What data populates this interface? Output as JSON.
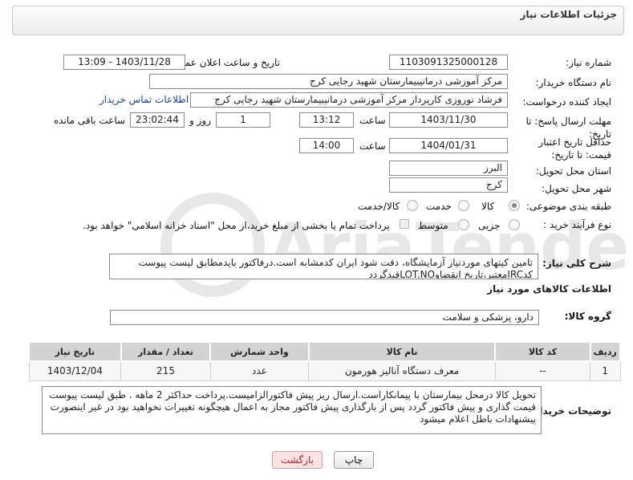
{
  "header": {
    "title": "جزئیات اطلاعات نیاز"
  },
  "form": {
    "need_number": {
      "label": "شماره نیاز:",
      "value": "1103091325000128"
    },
    "announce_datetime": {
      "label": "تاریخ و ساعت اعلان عمومی:",
      "value": "1403/11/28 - 13:09"
    },
    "buyer_org": {
      "label": "نام دستگاه خریدار:",
      "value": "مرکز آموزشی درمانیبیمارستان شهید رجایی کرج"
    },
    "creator": {
      "label": "ایجاد کننده درخواست:",
      "value": "فرشاد نوروزی کارپرداز مرکز آموزشی درمانیبیمارستان شهید رجایی کرج",
      "contact_link": "اطلاعات تماس خریدار"
    },
    "reply_deadline": {
      "label": "مهلت ارسال پاسخ: تا تاریخ:",
      "date": "1403/11/30",
      "time_label": "ساعت",
      "time": "13:12",
      "days": "1",
      "days_label": "روز و",
      "remaining": "23:02:44",
      "remaining_label": "ساعت باقی مانده"
    },
    "price_validity": {
      "label": "حداقل تاریخ اعتبار قیمت: تا تاریخ:",
      "date": "1404/01/31",
      "time_label": "ساعت",
      "time": "14:00"
    },
    "province": {
      "label": "استان محل تحویل:",
      "value": "البرز"
    },
    "city": {
      "label": "شهر محل تحویل:",
      "value": "کرج"
    },
    "category": {
      "label": "طبقه بندی موضوعی:",
      "options": [
        "کالا",
        "خدمت",
        "کالا/خدمت"
      ],
      "selected": "کالا"
    },
    "purchase_type": {
      "label": "نوع فرآیند خرید :",
      "options": [
        "جزیی",
        "متوسط"
      ],
      "payment_note": "پرداخت تمام یا بخشی از مبلغ خرید،از محل \"اسناد خزانه اسلامی\" خواهد بود."
    }
  },
  "description": {
    "label": "شرح کلی نیاز:",
    "line1": "تامین کیتهای موردنیاز آزمایشگاه، دقت شود ایران کدمشابه است.درفاکتور بایدمطابق لیست پیوست",
    "line2": "کدIRCمعتبر،تاریخ انقضاوLOT.NOقیدگردد"
  },
  "goods_info": {
    "title": "اطلاعات کالاهای مورد نیاز"
  },
  "goods_group": {
    "label": "گروه کالا:",
    "value": "دارو، پزشکی و سلامت"
  },
  "table": {
    "headers": [
      "ردیف",
      "کد کالا",
      "نام کالا",
      "واحد شمارش",
      "تعداد / مقدار",
      "تاریخ نیاز"
    ],
    "rows": [
      [
        "1",
        "--",
        "معرف دستگاه آنالیز هورمون",
        "عدد",
        "215",
        "1403/12/04"
      ]
    ]
  },
  "buyer_notes": {
    "label": "توضیحات خریدار:",
    "text": "تحویل کالا درمحل بیمارستان با پیمانکاراست.ارسال ریز پیش فاکتورالزامیست.پرداخت حداکثر 2 ماهه . طبق لیست پیوست قیمت گذاری و پیش فاکتور گردد پس از بارگذاری پیش فاکتور مجاز به اعمال هیچگونه تغییرات نخواهید بود در غیر اینصورت پیشنهادات باطل اعلام میشود"
  },
  "buttons": {
    "print": "چاپ",
    "back": "بازگشت"
  },
  "watermark": {
    "text": "AriaTender.neT"
  },
  "colors": {
    "link": "#1a3fa8",
    "back_button_bg": "#fbe3e3",
    "back_button_text": "#c02020",
    "table_header_bg": "#d3d3d3"
  }
}
